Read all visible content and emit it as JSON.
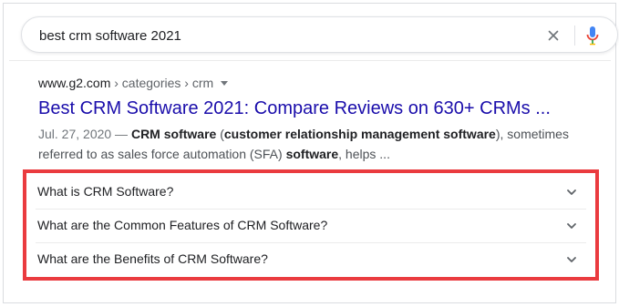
{
  "search": {
    "query": "best crm software 2021"
  },
  "result": {
    "domain": "www.g2.com",
    "path": " › categories › crm",
    "title": "Best CRM Software 2021: Compare Reviews on 630+ CRMs ...",
    "snippet": {
      "date": "Jul. 27, 2020 — ",
      "parts": [
        {
          "text": "CRM software",
          "bold": true
        },
        {
          "text": " (",
          "bold": false
        },
        {
          "text": "customer relationship management software",
          "bold": true
        },
        {
          "text": "), sometimes referred to as sales force automation (SFA) ",
          "bold": false
        },
        {
          "text": "software",
          "bold": true
        },
        {
          "text": ", helps ...",
          "bold": false
        }
      ]
    }
  },
  "people_also_ask": [
    {
      "question": "What is CRM Software?"
    },
    {
      "question": "What are the Common Features of CRM Software?"
    },
    {
      "question": "What are the Benefits of CRM Software?"
    }
  ],
  "icons": {
    "clear": "close-icon",
    "mic": "microphone-icon",
    "expand": "chevron-down-icon",
    "crumb_menu": "caret-down-icon"
  },
  "colors": {
    "title_link": "#1a0dab",
    "highlight_border": "#ea3b3f",
    "mic_blue": "#4285f4",
    "mic_red": "#ea4335"
  }
}
